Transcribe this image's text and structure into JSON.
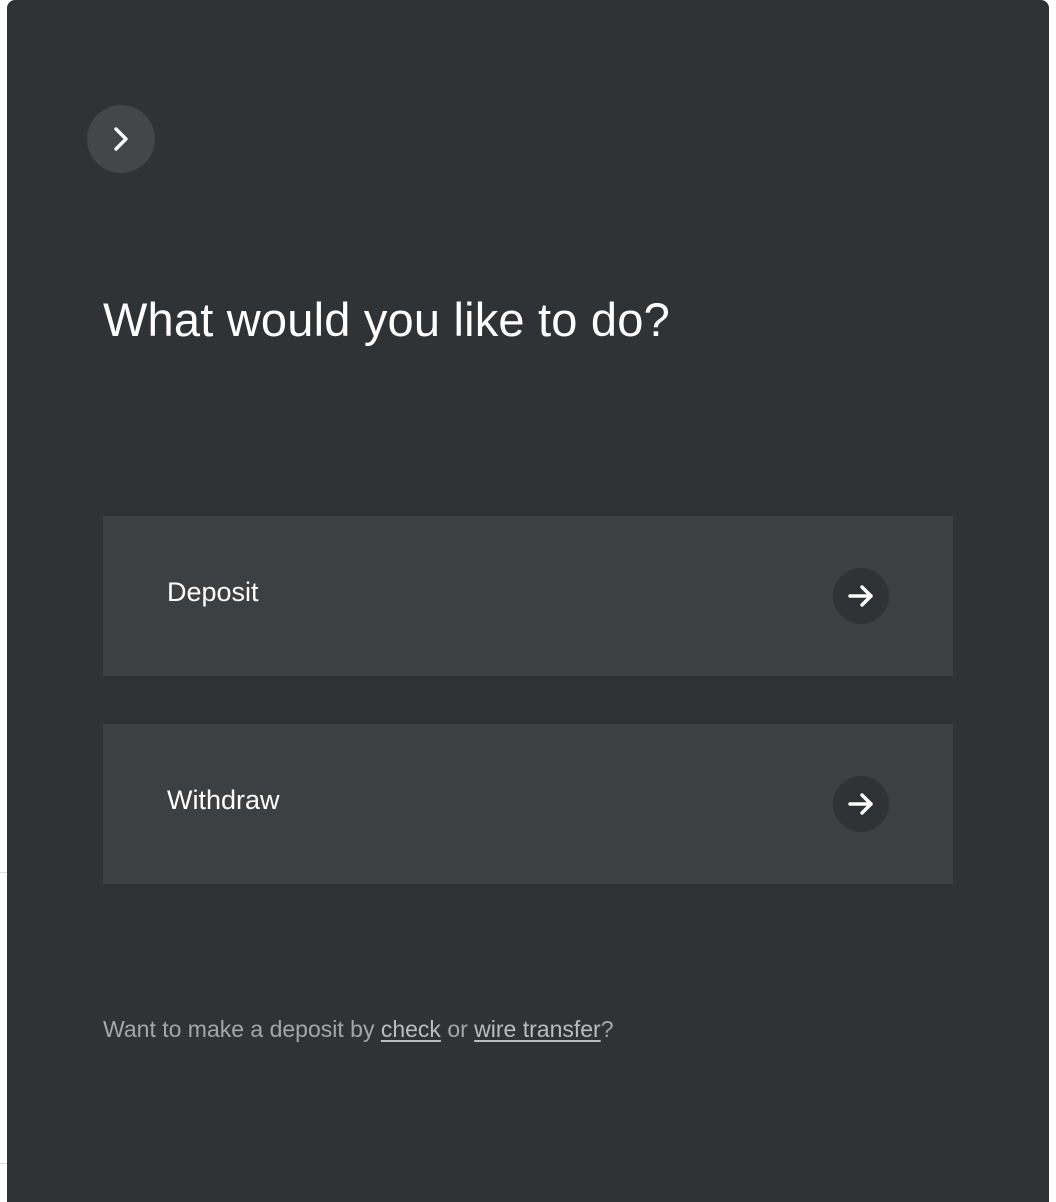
{
  "panel": {
    "title": "What would you like to do?",
    "collapse_icon": "chevron-right-icon"
  },
  "options": [
    {
      "label": "Deposit",
      "icon": "arrow-right-icon"
    },
    {
      "label": "Withdraw",
      "icon": "arrow-right-icon"
    }
  ],
  "footer": {
    "prefix": "Want to make a deposit by ",
    "check_link": "check",
    "middle": " or ",
    "wire_link": "wire transfer",
    "suffix": "?"
  },
  "colors": {
    "panel_background": "#2f3336",
    "card_background": "#3c4043",
    "text_primary": "#ffffff",
    "text_muted": "#a3a7aa"
  }
}
